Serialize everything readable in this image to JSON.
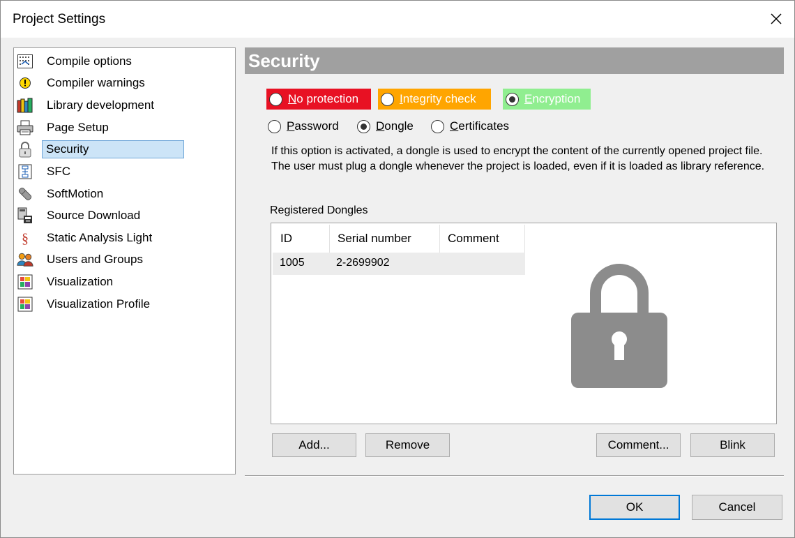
{
  "window": {
    "title": "Project Settings",
    "close_glyph": "✕"
  },
  "tree": {
    "items": [
      {
        "label": "Compile options",
        "icon": "compile-options-icon"
      },
      {
        "label": "Compiler warnings",
        "icon": "warning-icon"
      },
      {
        "label": "Library development",
        "icon": "library-icon"
      },
      {
        "label": "Page Setup",
        "icon": "printer-icon"
      },
      {
        "label": "Security",
        "icon": "padlock-icon",
        "selected": true
      },
      {
        "label": "SFC",
        "icon": "sfc-icon"
      },
      {
        "label": "SoftMotion",
        "icon": "softmotion-icon"
      },
      {
        "label": "Source Download",
        "icon": "source-download-icon"
      },
      {
        "label": "Static Analysis Light",
        "icon": "paragraph-icon"
      },
      {
        "label": "Users and Groups",
        "icon": "users-icon"
      },
      {
        "label": "Visualization",
        "icon": "visualization-icon"
      },
      {
        "label": "Visualization Profile",
        "icon": "visualization-profile-icon"
      }
    ]
  },
  "security": {
    "header": "Security",
    "protection_modes": [
      {
        "label": "No protection",
        "color": "#e81123",
        "text_color": "#ffffff",
        "checked": false
      },
      {
        "label": "Integrity check",
        "color": "#ffa500",
        "text_color": "#ffffff",
        "checked": false
      },
      {
        "label": "Encryption",
        "color": "#90ee90",
        "text_color": "#ffffff",
        "checked": true
      }
    ],
    "encryption_types": [
      {
        "label": "Password",
        "checked": false
      },
      {
        "label": "Dongle",
        "checked": true
      },
      {
        "label": "Certificates",
        "checked": false
      }
    ],
    "info_text": "If this option is activated, a dongle is used to encrypt the content of the currently opened project file. The user must plug a dongle whenever the project is loaded, even if it is loaded as library reference.",
    "group_label": "Registered Dongles",
    "table": {
      "columns": [
        "ID",
        "Serial number",
        "Comment"
      ],
      "rows": [
        {
          "id": "1005",
          "serial": "2-2699902",
          "comment": ""
        }
      ]
    },
    "buttons": {
      "add": "Add...",
      "remove": "Remove",
      "comment": "Comment...",
      "blink": "Blink"
    }
  },
  "footer": {
    "ok": "OK",
    "cancel": "Cancel"
  },
  "colors": {
    "accent": "#0078d7",
    "selection_bg": "#cce4f7",
    "header_bg": "#a0a0a0",
    "lock_gray": "#8c8c8c"
  }
}
